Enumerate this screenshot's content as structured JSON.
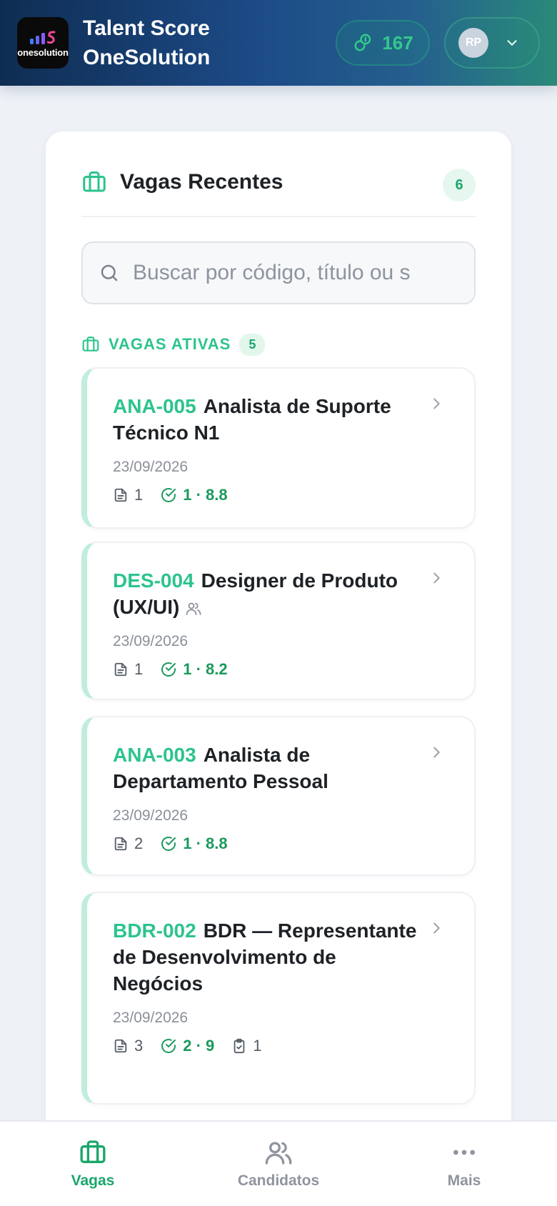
{
  "header": {
    "logo_text": "onesolution",
    "brand_line1": "Talent Score",
    "brand_line2": "OneSolution",
    "points": "167",
    "user_initials": "RP",
    "colors": {
      "accent": "#2cc48c",
      "header_start": "#0f2d52",
      "header_end": "#2a8a7a"
    }
  },
  "card": {
    "title": "Vagas Recentes",
    "count": "6",
    "search_placeholder": "Buscar por código, título ou s",
    "section": {
      "label": "VAGAS ATIVAS",
      "count": "5"
    },
    "jobs": [
      {
        "code": "ANA-005",
        "title": "Analista de Suporte Técnico N1",
        "date": "23/09/2026",
        "docs": "1",
        "score": "1 · 8.8",
        "tasks": ""
      },
      {
        "code": "DES-004",
        "title": "Designer de Produto (UX/UI)",
        "date": "23/09/2026",
        "docs": "1",
        "score": "1 · 8.2",
        "tasks": ""
      },
      {
        "code": "ANA-003",
        "title": "Analista de Departamento Pessoal",
        "date": "23/09/2026",
        "docs": "2",
        "score": "1 · 8.8",
        "tasks": ""
      },
      {
        "code": "BDR-002",
        "title": "BDR — Representante de Desenvolvimento de Negócios",
        "date": "23/09/2026",
        "docs": "3",
        "score": "2 · 9",
        "tasks": "1"
      }
    ]
  },
  "nav": {
    "items": [
      {
        "label": "Vagas",
        "icon": "briefcase-icon",
        "active": true
      },
      {
        "label": "Candidatos",
        "icon": "users-icon",
        "active": false
      },
      {
        "label": "Mais",
        "icon": "more-icon",
        "active": false
      }
    ]
  }
}
